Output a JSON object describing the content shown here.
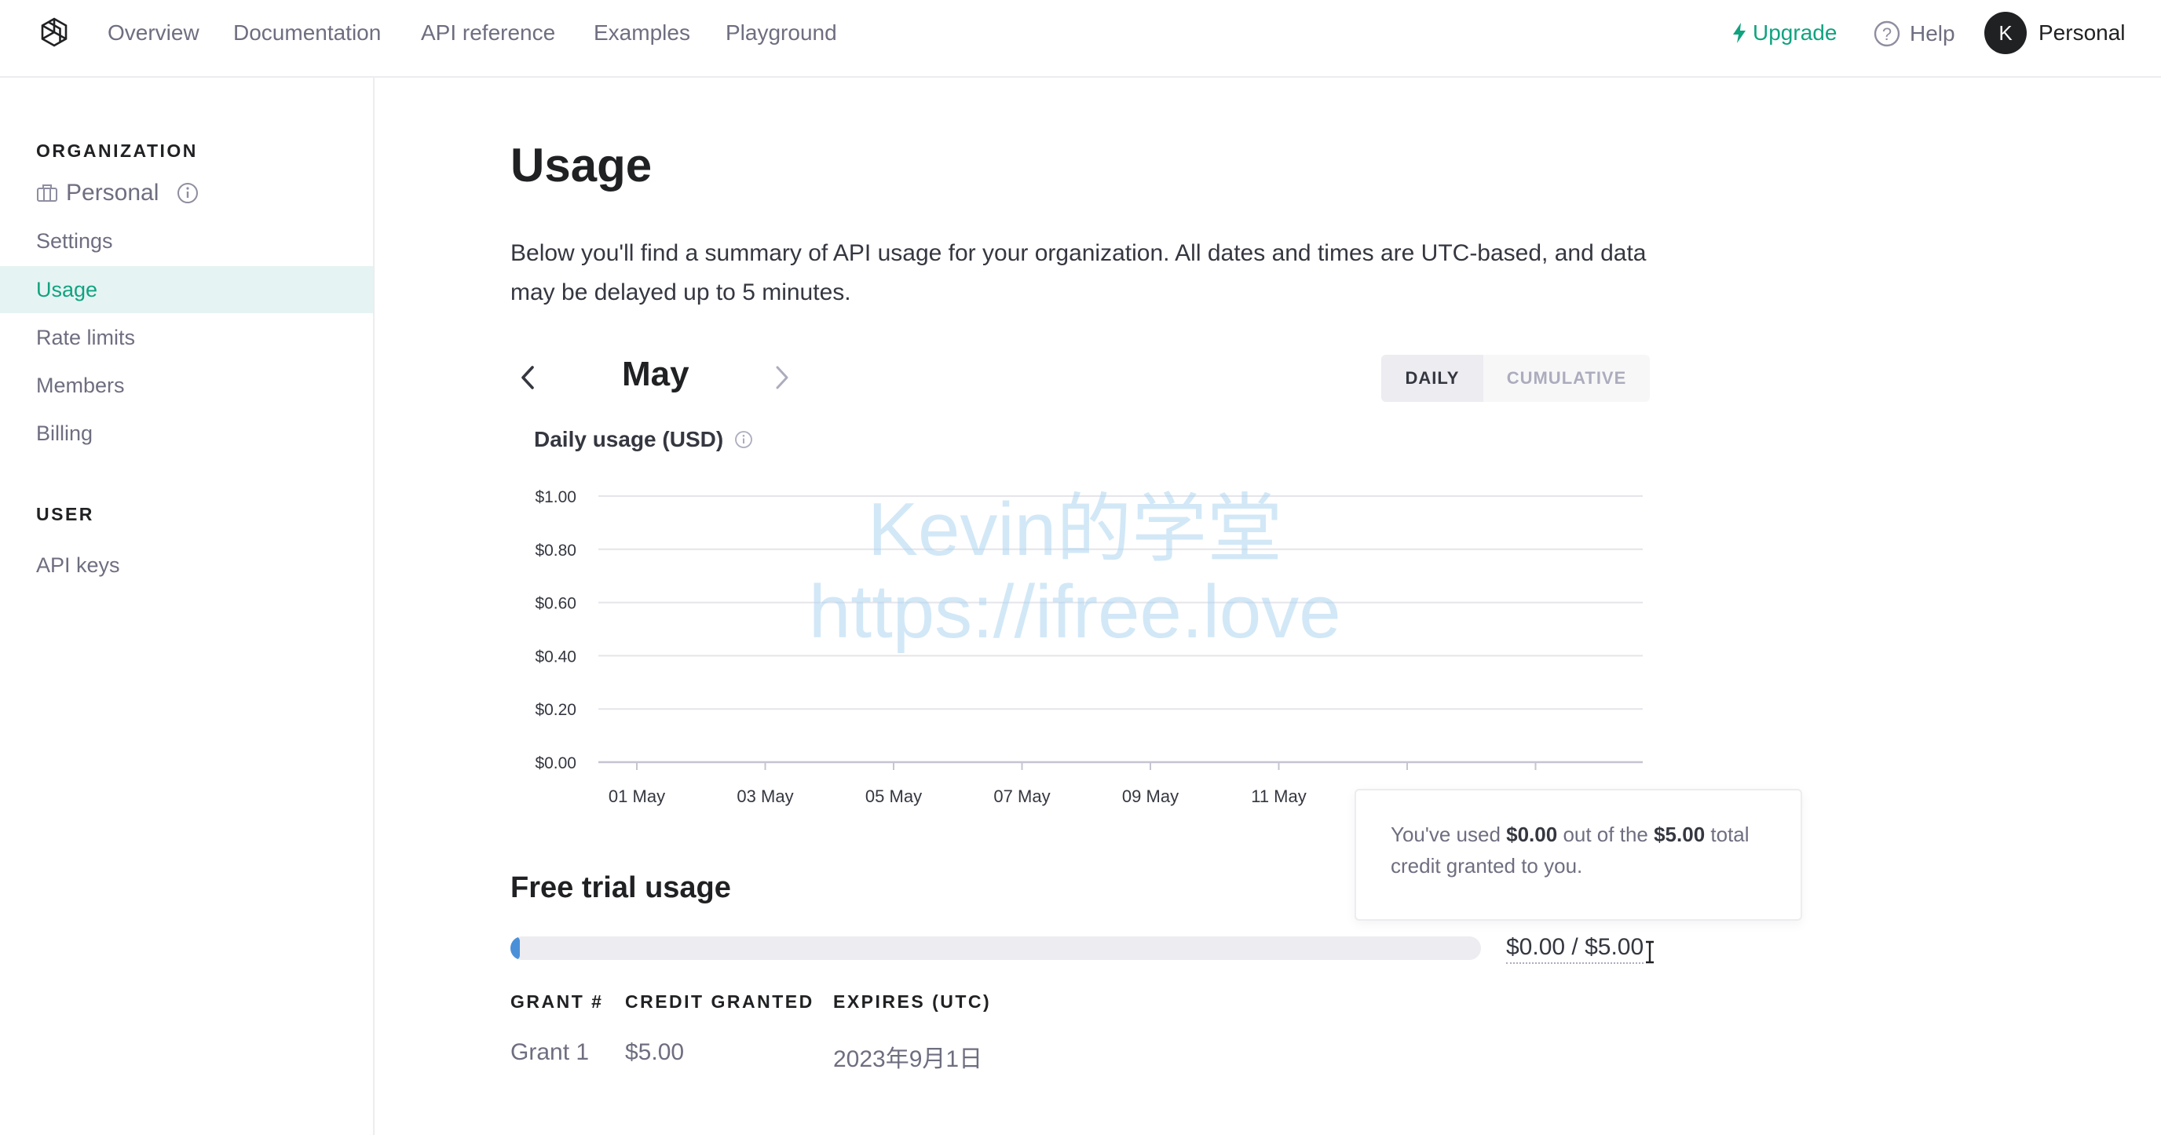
{
  "nav": {
    "links": [
      "Overview",
      "Documentation",
      "API reference",
      "Examples",
      "Playground"
    ],
    "upgrade": "Upgrade",
    "help": "Help",
    "avatar_initial": "K",
    "account": "Personal"
  },
  "sidebar": {
    "org_heading": "ORGANIZATION",
    "org_name": "Personal",
    "items": [
      "Settings",
      "Usage",
      "Rate limits",
      "Members",
      "Billing"
    ],
    "active_item": "Usage",
    "user_heading": "USER",
    "user_items": [
      "API keys"
    ]
  },
  "main": {
    "title": "Usage",
    "intro": "Below you'll find a summary of API usage for your organization. All dates and times are UTC-based, and data may be delayed up to 5 minutes.",
    "month": "May",
    "toggle": {
      "daily": "DAILY",
      "cumulative": "CUMULATIVE",
      "selected": "DAILY"
    }
  },
  "chart_data": {
    "type": "bar",
    "title": "Daily usage (USD)",
    "xlabel": "",
    "ylabel": "",
    "ylim": [
      0,
      1.0
    ],
    "y_ticks": [
      "$1.00",
      "$0.80",
      "$0.60",
      "$0.40",
      "$0.20",
      "$0.00"
    ],
    "categories": [
      "01 May",
      "03 May",
      "05 May",
      "07 May",
      "09 May",
      "11 May"
    ],
    "values": [
      0,
      0,
      0,
      0,
      0,
      0
    ],
    "grid": true
  },
  "watermark": {
    "line1": "Kevin的学堂",
    "line2": "https://ifree.love"
  },
  "tooltip": {
    "prefix": "You've used ",
    "used": "$0.00",
    "middle": " out of the ",
    "total": "$5.00",
    "suffix": " total credit granted to you."
  },
  "free_trial": {
    "title": "Free trial usage",
    "progress_fraction": 0.0,
    "progress_text": "$0.00 / $5.00"
  },
  "grants": {
    "headers": [
      "GRANT #",
      "CREDIT GRANTED",
      "EXPIRES (UTC)"
    ],
    "rows": [
      [
        "Grant 1",
        "$5.00",
        "2023年9月1日"
      ]
    ]
  },
  "colors": {
    "accent": "#10a37f",
    "progress": "#4a90d9",
    "active_bg": "#e6f3f3"
  }
}
